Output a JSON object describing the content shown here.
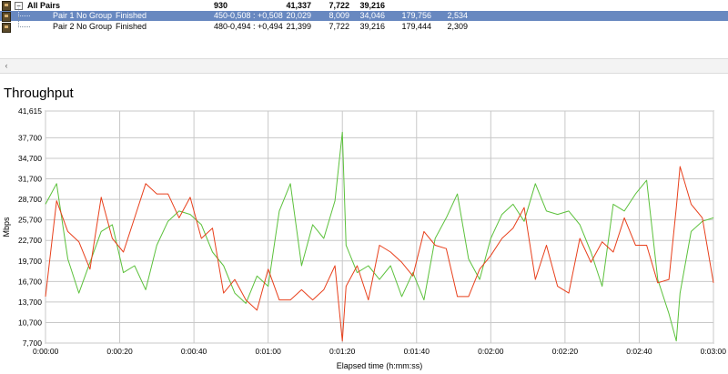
{
  "table": {
    "summary": {
      "label": "All Pairs",
      "records": "930",
      "col_avg": "41,337",
      "col_min": "7,722",
      "col_max": "39,216"
    },
    "pairs": [
      {
        "label": "Pair 1",
        "group": "No Group",
        "status": "Finished",
        "records": "450",
        "confidence": "-0,508 : +0,508",
        "avg": "20,029",
        "min": "8,009",
        "max": "34,046",
        "measured": "179,756",
        "relprec": "2,534",
        "selected": true
      },
      {
        "label": "Pair 2",
        "group": "No Group",
        "status": "Finished",
        "records": "480",
        "confidence": "-0,494 : +0,494",
        "avg": "21,399",
        "min": "7,722",
        "max": "39,216",
        "measured": "179,444",
        "relprec": "2,309",
        "selected": false
      }
    ]
  },
  "scrollbar": {
    "left_arrow": "‹"
  },
  "chart_data": {
    "type": "line",
    "title": "Throughput",
    "xlabel": "Elapsed time (h:mm:ss)",
    "ylabel": "Mbps",
    "x_ticks": [
      "0:00:00",
      "0:00:20",
      "0:00:40",
      "0:01:00",
      "0:01:20",
      "0:01:40",
      "0:02:00",
      "0:02:20",
      "0:02:40",
      "0:03:00"
    ],
    "y_ticks": [
      "41,615",
      "37,700",
      "34,700",
      "31,700",
      "28,700",
      "25,700",
      "22,700",
      "19,700",
      "16,700",
      "13,700",
      "10,700",
      "7,700"
    ],
    "xlim_seconds": [
      0,
      180
    ],
    "y_tick_values": [
      41.615,
      37.7,
      34.7,
      31.7,
      28.7,
      25.7,
      22.7,
      19.7,
      16.7,
      13.7,
      10.7,
      7.7
    ],
    "grid": true,
    "colors": {
      "pair1": "#e8401c",
      "pair2": "#5cc13c",
      "selection": "#6888c0"
    },
    "series": [
      {
        "name": "Pair 1",
        "color": "#e8401c",
        "x": [
          0,
          3,
          6,
          9,
          12,
          15,
          18,
          21,
          24,
          27,
          30,
          33,
          36,
          39,
          42,
          45,
          48,
          51,
          54,
          57,
          60,
          63,
          66,
          69,
          72,
          75,
          78,
          80,
          81,
          84,
          87,
          90,
          93,
          96,
          99,
          102,
          105,
          108,
          111,
          114,
          117,
          120,
          123,
          126,
          129,
          132,
          135,
          138,
          141,
          144,
          147,
          150,
          153,
          156,
          159,
          162,
          165,
          168,
          170,
          171,
          174,
          177,
          180
        ],
        "values": [
          14.5,
          28.5,
          24,
          22.5,
          18.5,
          29,
          23,
          21,
          26,
          31,
          29.5,
          29.5,
          26,
          29,
          23,
          24.5,
          15,
          17,
          14,
          12.5,
          18.5,
          14,
          14,
          15.5,
          14,
          15.5,
          19,
          8,
          16,
          19,
          14,
          22,
          21,
          19.5,
          17.5,
          24,
          22,
          21.5,
          14.5,
          14.5,
          18.5,
          20.5,
          23,
          24.5,
          27.5,
          17,
          22,
          16,
          15,
          23,
          19.5,
          22.5,
          21,
          26,
          22,
          22,
          16.5,
          17,
          27.5,
          33.5,
          28,
          26,
          16.5
        ]
      },
      {
        "name": "Pair 2",
        "color": "#5cc13c",
        "x": [
          0,
          3,
          6,
          9,
          12,
          15,
          18,
          21,
          24,
          27,
          30,
          33,
          36,
          39,
          42,
          45,
          48,
          51,
          54,
          57,
          60,
          63,
          66,
          69,
          72,
          75,
          78,
          80,
          81,
          84,
          87,
          90,
          93,
          96,
          99,
          102,
          105,
          108,
          111,
          114,
          117,
          120,
          123,
          126,
          129,
          132,
          135,
          138,
          141,
          144,
          147,
          150,
          153,
          156,
          159,
          162,
          165,
          168,
          170,
          171,
          174,
          177,
          180
        ],
        "values": [
          28,
          31,
          20,
          15,
          19.5,
          24,
          25,
          18,
          19,
          15.5,
          22,
          25.5,
          27,
          26.5,
          25,
          21,
          19,
          15,
          13.5,
          17.5,
          16,
          27,
          31,
          19,
          25,
          23,
          28.5,
          38.5,
          22,
          18,
          19,
          17,
          19,
          14.5,
          18,
          14,
          23,
          26,
          29.5,
          20,
          17,
          23,
          26.5,
          28,
          25.5,
          31,
          27,
          26.5,
          27,
          25,
          21,
          16,
          28,
          27,
          29.5,
          31.5,
          17,
          12,
          8,
          15,
          24,
          25.5,
          26
        ]
      }
    ]
  }
}
